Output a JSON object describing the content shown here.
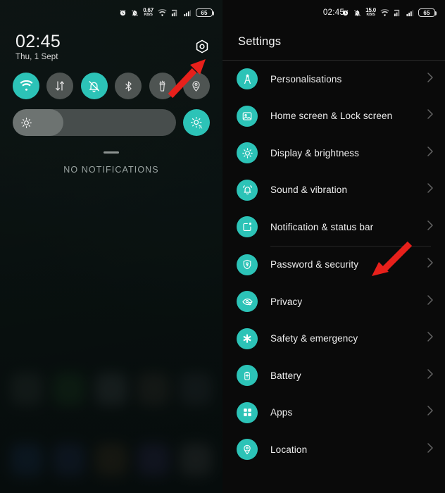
{
  "left_panel": {
    "name": "notification-shade",
    "status_bar": {
      "alarm_icon": "alarm-icon",
      "silent_icon": "bell-off-icon",
      "net_speed_value": "0.67",
      "net_speed_unit": "KB/S",
      "wifi_icon": "wifi-icon",
      "sim_signal_icon": "sim-signal-icon",
      "signal_icon": "signal-bars-icon",
      "battery_level": "65"
    },
    "clock": {
      "time": "02:45",
      "date": "Thu, 1 Sept"
    },
    "settings_gear": "gear-icon",
    "toggles": [
      {
        "name": "wifi",
        "label": "Wi-Fi",
        "icon": "wifi-icon",
        "active": true
      },
      {
        "name": "mobile-data",
        "label": "Mobile data",
        "icon": "data-arrows-icon",
        "active": false
      },
      {
        "name": "silent",
        "label": "Silent",
        "icon": "bell-off-icon",
        "active": true
      },
      {
        "name": "bluetooth",
        "label": "Bluetooth",
        "icon": "bluetooth-icon",
        "active": false
      },
      {
        "name": "flashlight",
        "label": "Flashlight",
        "icon": "flashlight-icon",
        "active": false
      },
      {
        "name": "location",
        "label": "Location",
        "icon": "location-pin-icon",
        "active": false
      }
    ],
    "brightness": {
      "icon": "brightness-sun-icon",
      "fill_percent": "31",
      "auto_button_icon": "auto-brightness-icon"
    },
    "notifications": {
      "empty_text": "NO NOTIFICATIONS"
    },
    "annotation_arrow": "red-arrow-pointing-to-settings-gear"
  },
  "right_panel": {
    "name": "settings-app",
    "status_bar": {
      "time": "02:45",
      "alarm_icon": "alarm-icon",
      "silent_icon": "bell-off-icon",
      "net_speed_value": "15.0",
      "net_speed_unit": "KB/S",
      "wifi_icon": "wifi-icon",
      "sim_signal_icon": "sim-signal-icon",
      "signal_icon": "signal-bars-icon",
      "battery_level": "65"
    },
    "title": "Settings",
    "items": [
      {
        "label": "Personalisations",
        "icon": "compass-icon",
        "chevron": "chevron-right-icon",
        "divider_after": false
      },
      {
        "label": "Home screen & Lock screen",
        "icon": "image-icon",
        "chevron": "chevron-right-icon",
        "divider_after": false
      },
      {
        "label": "Display & brightness",
        "icon": "sun-icon",
        "chevron": "chevron-right-icon",
        "divider_after": false
      },
      {
        "label": "Sound & vibration",
        "icon": "bell-ring-icon",
        "chevron": "chevron-right-icon",
        "divider_after": false
      },
      {
        "label": "Notification & status bar",
        "icon": "notification-icon",
        "chevron": "chevron-right-icon",
        "divider_after": true
      },
      {
        "label": "Password & security",
        "icon": "shield-lock-icon",
        "chevron": "chevron-right-icon",
        "divider_after": false,
        "highlighted": true
      },
      {
        "label": "Privacy",
        "icon": "eye-icon",
        "chevron": "chevron-right-icon",
        "divider_after": false
      },
      {
        "label": "Safety & emergency",
        "icon": "emergency-star-icon",
        "chevron": "chevron-right-icon",
        "divider_after": false
      },
      {
        "label": "Battery",
        "icon": "battery-icon",
        "chevron": "chevron-right-icon",
        "divider_after": false
      },
      {
        "label": "Apps",
        "icon": "apps-grid-icon",
        "chevron": "chevron-right-icon",
        "divider_after": false
      },
      {
        "label": "Location",
        "icon": "location-pin-icon",
        "chevron": "chevron-right-icon",
        "divider_after": false
      }
    ],
    "annotation_arrow": "red-arrow-pointing-to-password-and-security"
  },
  "colors": {
    "accent_teal": "#2cc3b7",
    "toggle_inactive": "#4e5452",
    "annotation_red": "#e8201b",
    "settings_bg": "#0a0a0a"
  }
}
